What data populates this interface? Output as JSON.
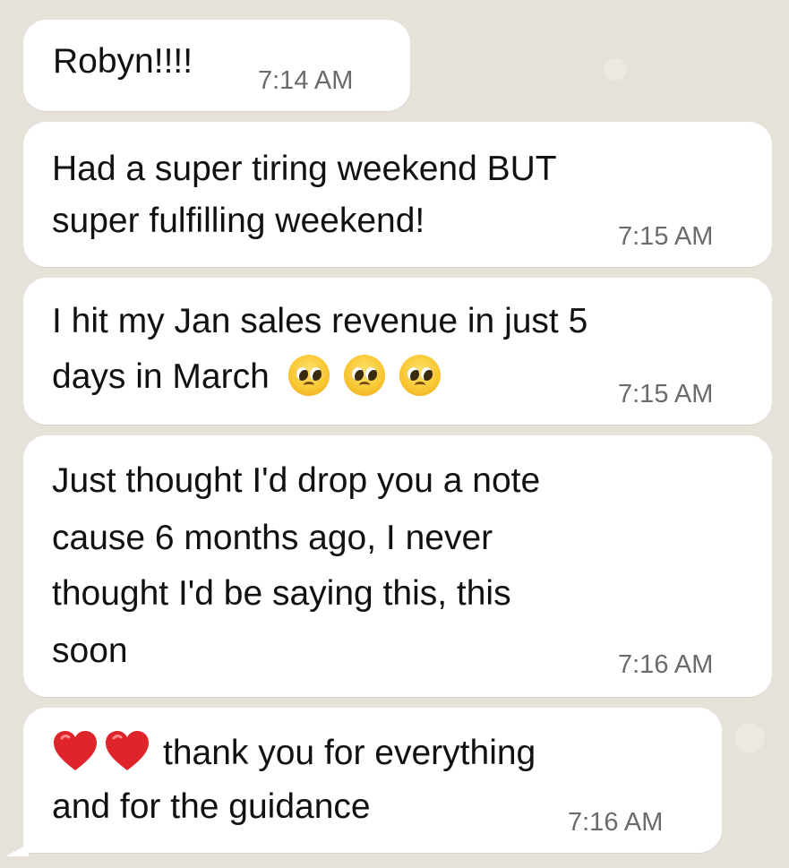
{
  "messages": [
    {
      "id": "m1",
      "text_lines": [
        "Robyn!!!!"
      ],
      "time": "7:14 AM"
    },
    {
      "id": "m2",
      "text_lines": [
        "Had a super tiring weekend BUT",
        "super fulfilling weekend!"
      ],
      "time": "7:15 AM"
    },
    {
      "id": "m3",
      "text_lines": [
        "I hit my Jan sales revenue in just 5",
        "days in March"
      ],
      "emojis": [
        "pleading-face-icon",
        "pleading-face-icon",
        "pleading-face-icon"
      ],
      "time": "7:15 AM"
    },
    {
      "id": "m4",
      "text_lines": [
        "Just thought I'd drop you a note",
        "cause 6 months ago, I never",
        "thought I'd be saying this, this",
        "soon"
      ],
      "time": "7:16 AM"
    },
    {
      "id": "m5",
      "emojis": [
        "red-heart-icon",
        "red-heart-icon"
      ],
      "text_lines": [
        "thank you for everything",
        "and for the guidance"
      ],
      "time": "7:16 AM"
    }
  ],
  "colors": {
    "bubble": "#ffffff",
    "background": "#e6e2da",
    "text": "#111111",
    "timestamp": "#6b6b6b",
    "heart": "#e0242b"
  }
}
